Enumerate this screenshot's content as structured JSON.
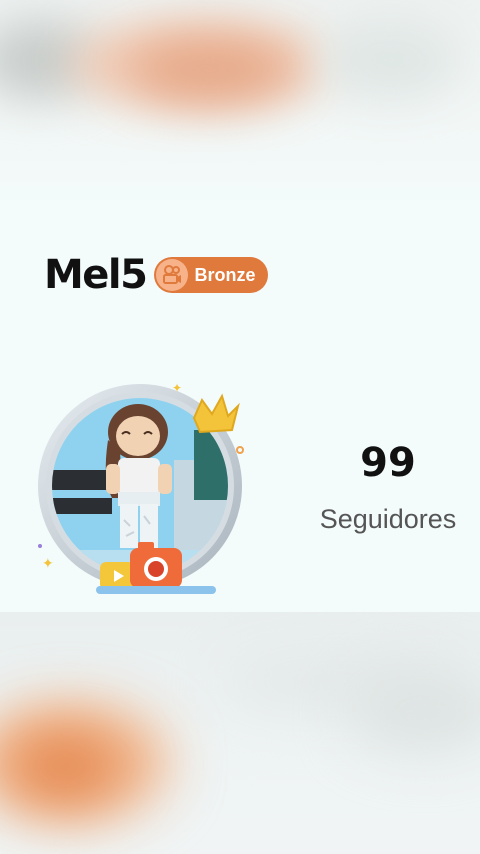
{
  "profile": {
    "username": "Mel5",
    "badge_label": "Bronze",
    "badge_icon": "camera-reel-icon"
  },
  "stats": {
    "followers_count": "99",
    "followers_label": "Seguidores"
  },
  "colors": {
    "badge": "#e07a3c",
    "badge_icon_bg": "#f7b28a",
    "background": "#f3fbfb"
  }
}
